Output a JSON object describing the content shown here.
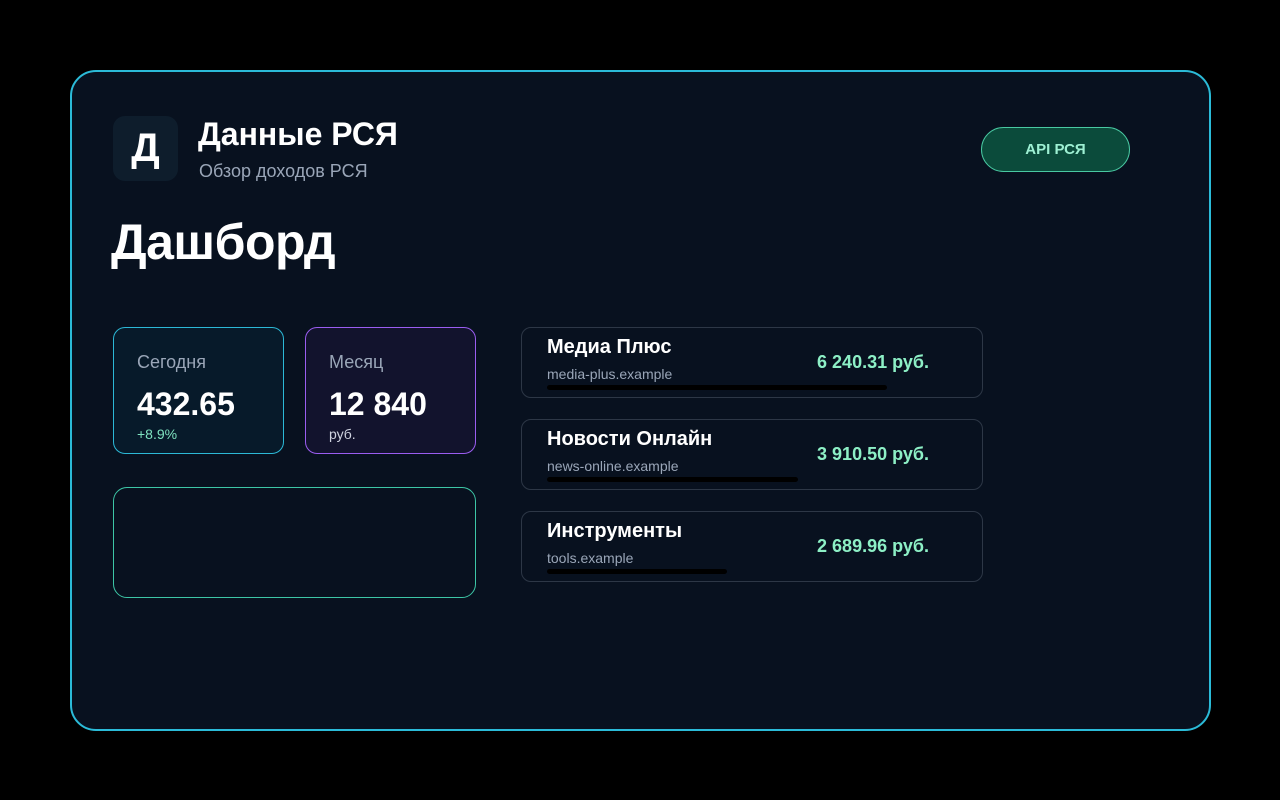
{
  "header": {
    "logo_letter": "Д",
    "title": "Данные РСЯ",
    "subtitle": "Обзор доходов РСЯ",
    "api_button": "API РСЯ"
  },
  "page": {
    "title": "Дашборд"
  },
  "stats": {
    "today": {
      "label": "Сегодня",
      "value": "432.65",
      "sub": "+8.9%"
    },
    "month": {
      "label": "Месяц",
      "value": "12 840",
      "sub": "руб."
    }
  },
  "sites": [
    {
      "name": "Медиа Плюс",
      "domain": "media-plus.example",
      "amount": "6 240.31 руб.",
      "share": 1.0
    },
    {
      "name": "Новости Онлайн",
      "domain": "news-online.example",
      "amount": "3 910.50 руб.",
      "share": 0.737
    },
    {
      "name": "Инструменты",
      "domain": "tools.example",
      "amount": "2 689.96 руб.",
      "share": 0.53
    }
  ],
  "colors": {
    "accent_cyan": "#2bbbd8",
    "accent_purple": "#9a5df0",
    "accent_green": "#3dc6a6",
    "amount_green": "#8df0c6"
  }
}
